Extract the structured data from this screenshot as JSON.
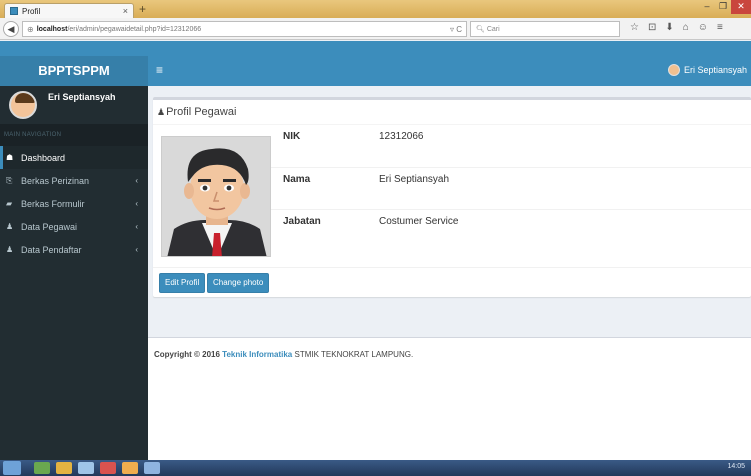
{
  "browser": {
    "tab_title": "Profil",
    "tab_close": "×",
    "new_tab": "+",
    "url_host": "localhost",
    "url_path": "/eri/admin/pegawaidetail.php?id=12312066",
    "search_placeholder": "Cari",
    "window_controls": [
      "–",
      "❐",
      "✕"
    ],
    "tools": [
      "☆",
      "⊡",
      "⬇",
      "⌂",
      "☺",
      "≡"
    ]
  },
  "app": {
    "logo": "BPPTSPPM",
    "toggle_icon": "≡",
    "user_name": "Eri Septiansyah"
  },
  "sidebar": {
    "user_name": "Eri Septiansyah",
    "nav_header": "MAIN NAVIGATION",
    "items": [
      {
        "label": "Dashboard",
        "icon": "☗",
        "active": true
      },
      {
        "label": "Berkas Perizinan",
        "icon": "⎘",
        "chevron": "‹"
      },
      {
        "label": "Berkas Formulir",
        "icon": "▰",
        "chevron": "‹"
      },
      {
        "label": "Data Pegawai",
        "icon": "♟",
        "chevron": "‹"
      },
      {
        "label": "Data Pendaftar",
        "icon": "♟",
        "chevron": "‹"
      }
    ]
  },
  "profile": {
    "title": "Profil Pegawai",
    "title_icon": "♟",
    "fields": [
      {
        "key": "NIK",
        "value": "12312066"
      },
      {
        "key": "Nama",
        "value": "Eri Septiansyah"
      },
      {
        "key": "Jabatan",
        "value": "Costumer Service"
      }
    ],
    "buttons": {
      "edit": "Edit Profil",
      "change_photo": "Change photo"
    }
  },
  "footer": {
    "prefix": "Copyright © 2016",
    "link": "Teknik Informatika",
    "suffix": "STMIK TEKNOKRAT LAMPUNG."
  },
  "taskbar": {
    "clock": "14:05"
  },
  "colors": {
    "primary": "#3c8dbc",
    "sidebar": "#222d32",
    "logo_bg": "#367fa9"
  }
}
